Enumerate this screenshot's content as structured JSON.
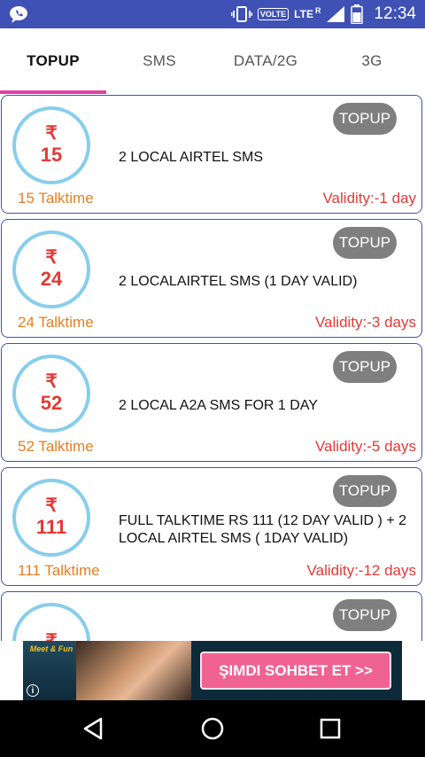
{
  "status_bar": {
    "volte_label": "VOLTE",
    "lte_label": "LTE",
    "roaming_label": "R",
    "time": "12:34"
  },
  "tabs": [
    {
      "label": "TOPUP",
      "active": true
    },
    {
      "label": "SMS",
      "active": false
    },
    {
      "label": "DATA/2G",
      "active": false
    },
    {
      "label": "3G",
      "active": false
    }
  ],
  "currency_symbol": "₹",
  "plans": [
    {
      "amount": "15",
      "description": "2 LOCAL AIRTEL SMS",
      "talktime": "15 Talktime",
      "validity": "Validity:-1 day",
      "badge": "TOPUP"
    },
    {
      "amount": "24",
      "description": "2 LOCALAIRTEL SMS (1 DAY VALID)",
      "talktime": "24 Talktime",
      "validity": "Validity:-3 days",
      "badge": "TOPUP"
    },
    {
      "amount": "52",
      "description": "2 LOCAL A2A SMS FOR 1 DAY",
      "talktime": "52 Talktime",
      "validity": "Validity:-5 days",
      "badge": "TOPUP"
    },
    {
      "amount": "111",
      "description": "FULL TALKTIME RS 111 (12 DAY VALID ) + 2 LOCAL AIRTEL SMS ( 1DAY VALID)",
      "talktime": "111 Talktime",
      "validity": "Validity:-12 days",
      "badge": "TOPUP"
    },
    {
      "amount": "",
      "description": "",
      "talktime": "",
      "validity": "",
      "badge": "TOPUP"
    }
  ],
  "ad": {
    "brand": "Meet & Fun",
    "cta": "ŞIMDI SOHBET ET >>",
    "info_icon": "i"
  },
  "colors": {
    "status_bar": "#3f51b5",
    "tab_indicator": "#e040a0",
    "card_border": "#3f51b5",
    "circle_ring": "#87ceeb",
    "amount_text": "#e53935",
    "talktime_text": "#e67e22",
    "validity_text": "#e53935",
    "badge_bg": "#7f7f7f"
  }
}
